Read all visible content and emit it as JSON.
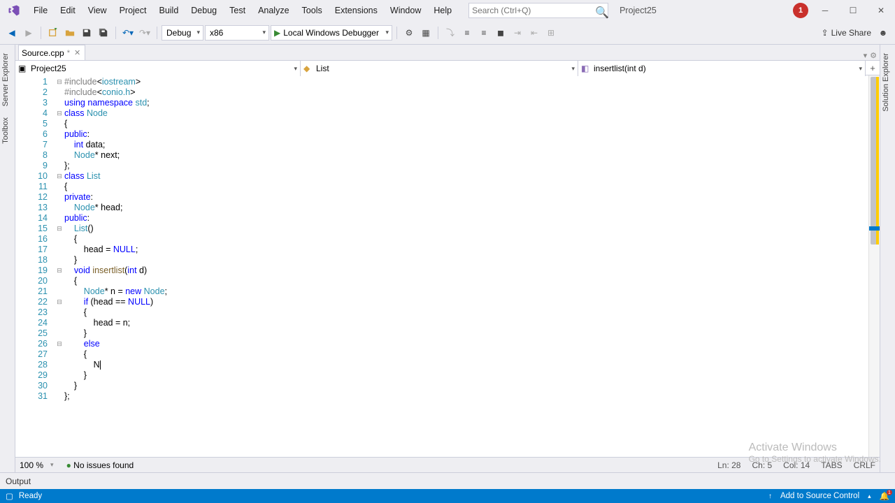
{
  "menu": {
    "file": "File",
    "edit": "Edit",
    "view": "View",
    "project": "Project",
    "build": "Build",
    "debug": "Debug",
    "test": "Test",
    "analyze": "Analyze",
    "tools": "Tools",
    "extensions": "Extensions",
    "window": "Window",
    "help": "Help"
  },
  "search": {
    "placeholder": "Search (Ctrl+Q)"
  },
  "project_label": "Project25",
  "notif_count": "1",
  "toolbar": {
    "config": "Debug",
    "platform": "x86",
    "debug_target": "Local Windows Debugger",
    "live_share": "Live Share"
  },
  "left_rail": {
    "server_explorer": "Server Explorer",
    "toolbox": "Toolbox"
  },
  "right_rail": {
    "solution_explorer": "Solution Explorer"
  },
  "tab": {
    "filename": "Source.cpp",
    "modified": "*"
  },
  "nav": {
    "project": "Project25",
    "scope": "List",
    "member": "insertlist(int d)"
  },
  "code_lines": [
    "#include<iostream>",
    "#include<conio.h>",
    "using namespace std;",
    "class Node",
    "{",
    "public:",
    "    int data;",
    "    Node* next;",
    "};",
    "class List",
    "{",
    "private:",
    "    Node* head;",
    "public:",
    "    List()",
    "    {",
    "        head = NULL;",
    "    }",
    "    void insertlist(int d)",
    "    {",
    "        Node* n = new Node;",
    "        if (head == NULL)",
    "        {",
    "            head = n;",
    "        }",
    "        else",
    "        {",
    "            N",
    "        }",
    "    }",
    "};"
  ],
  "editor_status": {
    "zoom": "100 %",
    "issues": "No issues found",
    "ln": "Ln: 28",
    "ch": "Ch: 5",
    "col": "Col: 14",
    "tabs": "TABS",
    "crlf": "CRLF"
  },
  "output": {
    "title": "Output"
  },
  "statusbar": {
    "ready": "Ready",
    "source_control": "Add to Source Control"
  },
  "watermark": {
    "line1": "Activate Windows",
    "line2": "Go to Settings to activate Windows."
  }
}
